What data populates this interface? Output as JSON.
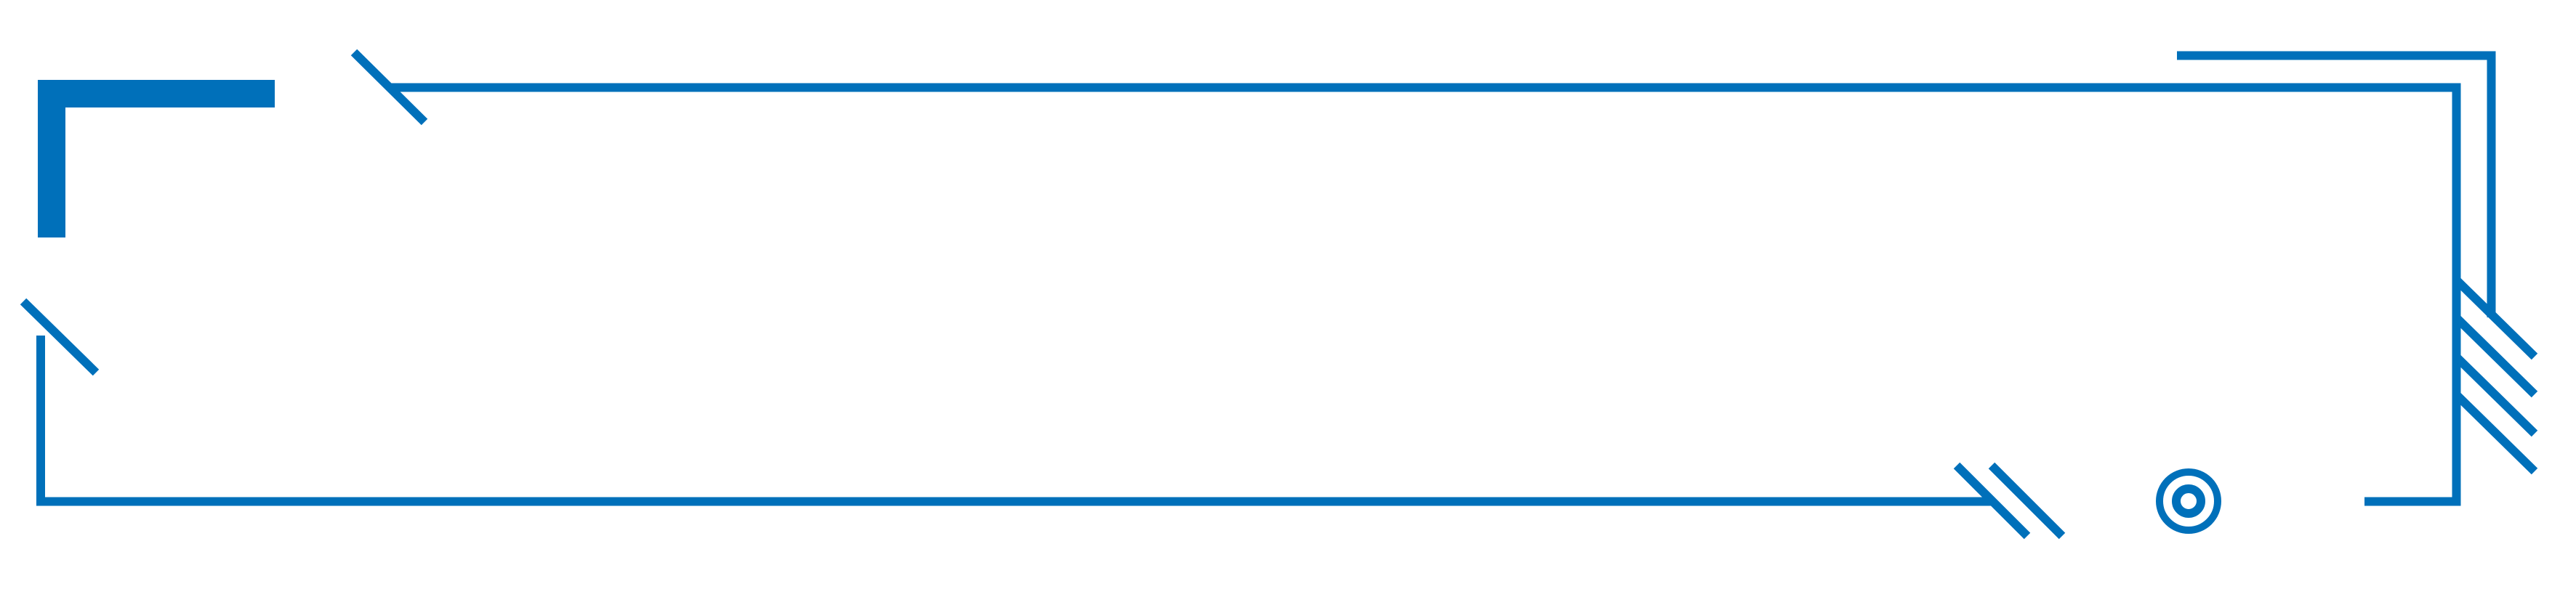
{
  "frame": {
    "accent_color": "#0070BA",
    "background_color": "#FFFFFF",
    "icons": {
      "corner_bracket": "corner-bracket-icon",
      "target": "target-circle-icon"
    }
  }
}
